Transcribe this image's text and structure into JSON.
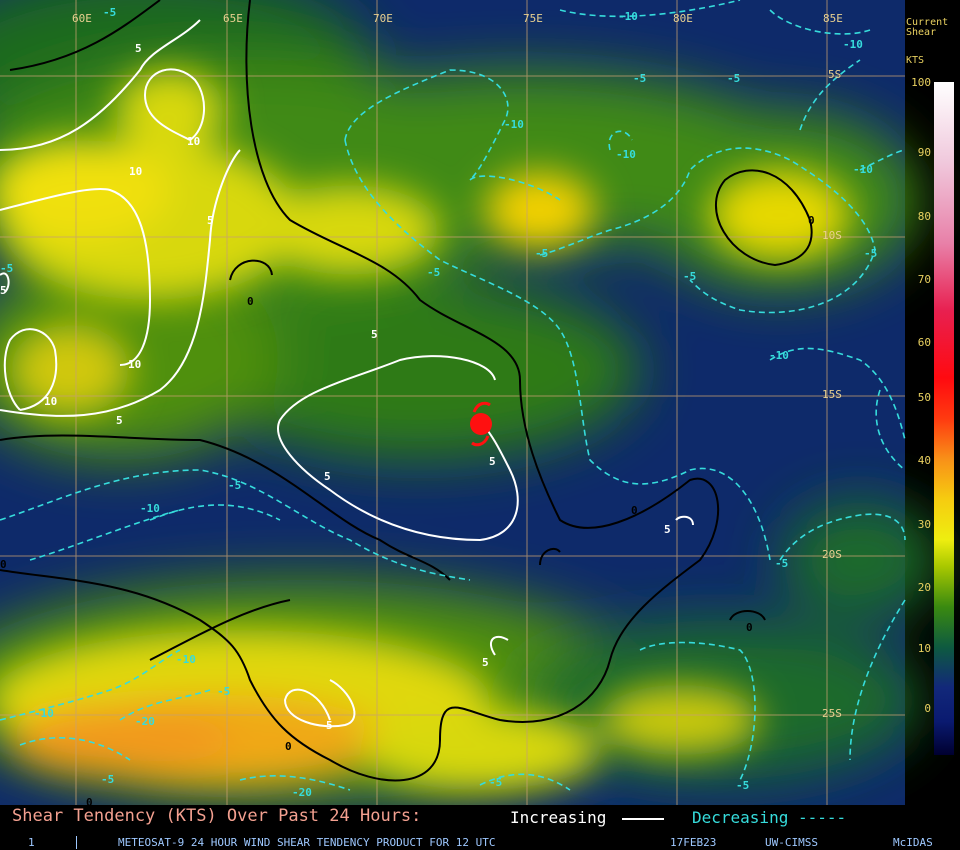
{
  "lon_labels": [
    "60E",
    "65E",
    "70E",
    "75E",
    "80E",
    "85E"
  ],
  "lat_labels": [
    "5S",
    "10S",
    "15S",
    "20S",
    "25S"
  ],
  "legend": {
    "title_line1": "Current",
    "title_line2": "Shear",
    "units": "KTS",
    "ticks": [
      "100",
      "90",
      "80",
      "70",
      "60",
      "50",
      "40",
      "30",
      "20",
      "10",
      "0"
    ]
  },
  "footer": {
    "title": "Shear Tendency (KTS) Over Past 24 Hours:",
    "increasing_label": "Increasing",
    "decreasing_label": "Decreasing -----",
    "frame_number": "1",
    "product": "METEOSAT-9 24 HOUR WIND SHEAR TENDENCY PRODUCT FOR 12 UTC",
    "date": "17FEB23",
    "source": "UW-CIMSS",
    "software": "McIDAS"
  },
  "contour_labels": [
    {
      "text": "-5",
      "color": "#36dcdc"
    },
    {
      "text": "5",
      "color": "#ffffff"
    },
    {
      "text": "10",
      "color": "#ffffff"
    },
    {
      "text": "10",
      "color": "#ffffff"
    },
    {
      "text": "5",
      "color": "#ffffff"
    },
    {
      "text": "0",
      "color": "#000000"
    },
    {
      "text": "5",
      "color": "#ffffff"
    },
    {
      "text": "10",
      "color": "#ffffff"
    },
    {
      "text": "10",
      "color": "#ffffff"
    },
    {
      "text": "5",
      "color": "#ffffff"
    },
    {
      "text": "5",
      "color": "#ffffff"
    },
    {
      "text": "5",
      "color": "#ffffff"
    },
    {
      "text": "5",
      "color": "#ffffff"
    },
    {
      "text": "-10",
      "color": "#36dcdc"
    },
    {
      "text": "-10",
      "color": "#36dcdc"
    },
    {
      "text": "-5",
      "color": "#36dcdc"
    },
    {
      "text": "-10",
      "color": "#36dcdc"
    },
    {
      "text": "-5",
      "color": "#36dcdc"
    },
    {
      "text": "-5",
      "color": "#36dcdc"
    },
    {
      "text": "-5",
      "color": "#36dcdc"
    },
    {
      "text": "-10",
      "color": "#36dcdc"
    },
    {
      "text": "-10",
      "color": "#36dcdc"
    },
    {
      "text": "0",
      "color": "#000000"
    },
    {
      "text": "-5",
      "color": "#36dcdc"
    },
    {
      "text": "-10",
      "color": "#36dcdc"
    },
    {
      "text": "-10",
      "color": "#36dcdc"
    },
    {
      "text": "-5",
      "color": "#36dcdc"
    },
    {
      "text": "0",
      "color": "#000000"
    },
    {
      "text": "5",
      "color": "#ffffff"
    },
    {
      "text": "-5",
      "color": "#36dcdc"
    },
    {
      "text": "-5",
      "color": "#36dcdc"
    },
    {
      "text": "0",
      "color": "#000000"
    },
    {
      "text": "5",
      "color": "#ffffff"
    },
    {
      "text": "-10",
      "color": "#36dcdc"
    },
    {
      "text": "-5",
      "color": "#36dcdc"
    },
    {
      "text": "-10",
      "color": "#36dcdc"
    },
    {
      "text": "-20",
      "color": "#36dcdc"
    },
    {
      "text": "5",
      "color": "#ffffff"
    },
    {
      "text": "0",
      "color": "#000000"
    },
    {
      "text": "-5",
      "color": "#36dcdc"
    },
    {
      "text": "-20",
      "color": "#36dcdc"
    },
    {
      "text": "-5",
      "color": "#36dcdc"
    },
    {
      "text": "-5",
      "color": "#36dcdc"
    },
    {
      "text": "0",
      "color": "#000000"
    },
    {
      "text": "0",
      "color": "#000000"
    },
    {
      "text": "-5",
      "color": "#36dcdc"
    }
  ],
  "colors": {
    "increasing": "#ffffff",
    "decreasing": "#36dcdc",
    "zero_line": "#000000",
    "storm_symbol": "#ff1010",
    "grid": "#c8a070"
  }
}
